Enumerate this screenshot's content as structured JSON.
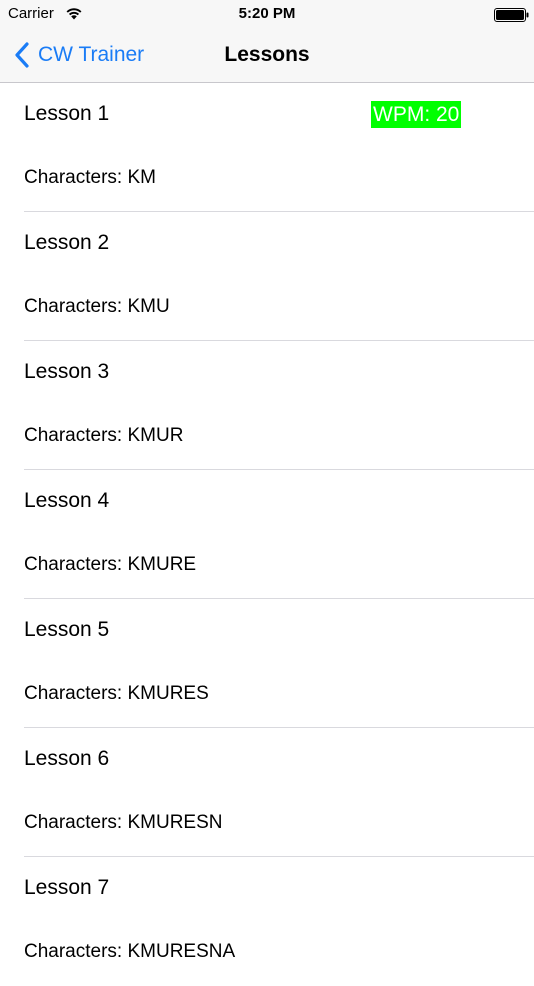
{
  "status_bar": {
    "carrier": "Carrier",
    "time": "5:20 PM",
    "wifi_icon": "wifi-icon",
    "battery_icon": "battery-icon"
  },
  "nav": {
    "back_label": "CW Trainer",
    "back_icon": "chevron-left-icon",
    "title": "Lessons"
  },
  "colors": {
    "accent": "#1a7cf6",
    "wpm_badge": "#00ff00"
  },
  "lessons": [
    {
      "title": "Lesson 1",
      "characters": "Characters: KM",
      "wpm": "WPM: 20"
    },
    {
      "title": "Lesson 2",
      "characters": "Characters: KMU"
    },
    {
      "title": "Lesson 3",
      "characters": "Characters: KMUR"
    },
    {
      "title": "Lesson 4",
      "characters": "Characters: KMURE"
    },
    {
      "title": "Lesson 5",
      "characters": "Characters: KMURES"
    },
    {
      "title": "Lesson 6",
      "characters": "Characters: KMURESN"
    },
    {
      "title": "Lesson 7",
      "characters": "Characters: KMURESNA"
    }
  ]
}
